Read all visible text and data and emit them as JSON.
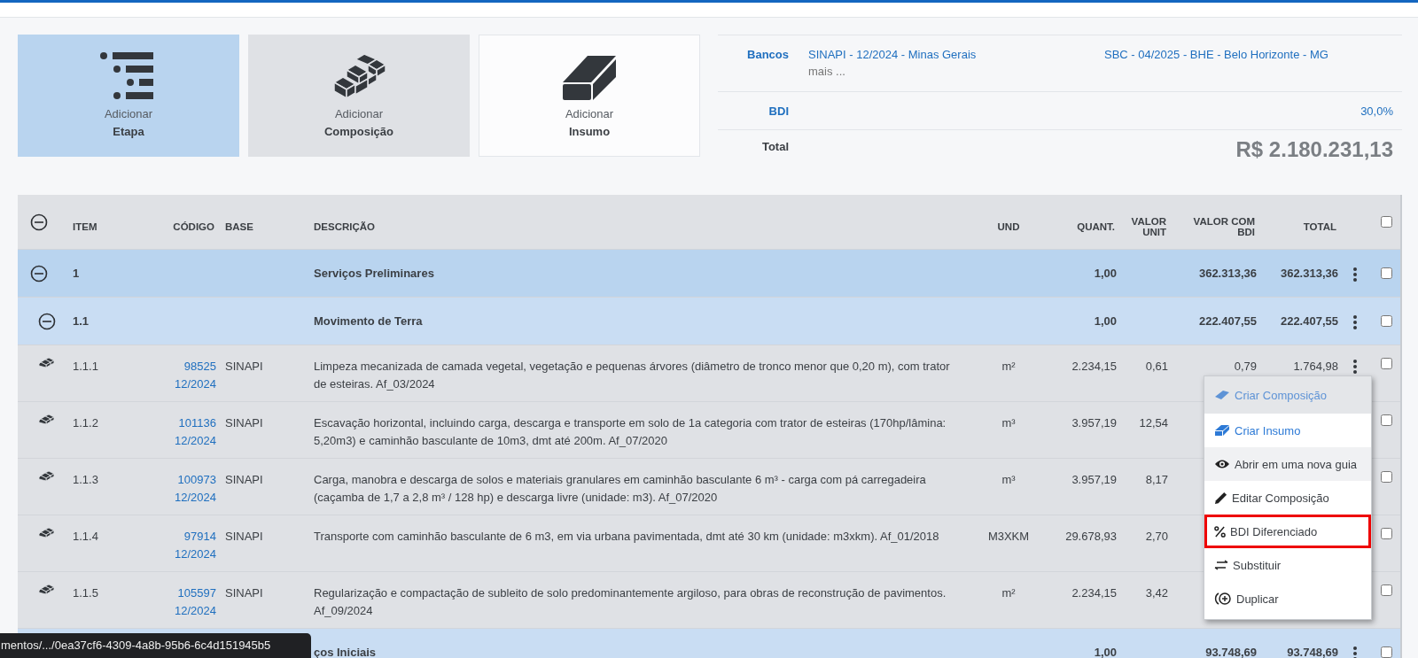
{
  "add_cards": [
    {
      "kind": "stages",
      "action": "Adicionar",
      "label": "Etapa",
      "selected": true,
      "hovered": false
    },
    {
      "kind": "bricks",
      "action": "Adicionar",
      "label": "Composição",
      "selected": false,
      "hovered": true
    },
    {
      "kind": "block",
      "action": "Adicionar",
      "label": "Insumo",
      "selected": false,
      "hovered": false
    }
  ],
  "summary": {
    "banks_label": "Bancos",
    "banks": [
      "SINAPI - 12/2024 - Minas Gerais",
      "SBC - 04/2025 - BHE - Belo Horizonte - MG"
    ],
    "more": "mais ...",
    "bdi_label": "BDI",
    "bdi": "30,0%",
    "total_label": "Total",
    "total": "R$ 2.180.231,13"
  },
  "table": {
    "header_expanded": true,
    "header_checked": false,
    "columns": [
      "ITEM",
      "CÓDIGO",
      "BASE",
      "DESCRIÇÃO",
      "UND",
      "QUANT.",
      "VALOR UNIT",
      "VALOR COM BDI",
      "TOTAL"
    ],
    "rows": [
      {
        "kind": "group",
        "item": "1",
        "description": "Serviços Preliminares",
        "quantity": "1,00",
        "value_bdi": "362.313,36",
        "total": "362.313,36",
        "expanded": true,
        "checked": false,
        "children": [
          {
            "kind": "group",
            "item": "1.1",
            "description": "Movimento de Terra",
            "quantity": "1,00",
            "value_bdi": "222.407,55",
            "total": "222.407,55",
            "expanded": true,
            "checked": false,
            "children": [
              {
                "kind": "item",
                "item": "1.1.1",
                "code": "98525",
                "version": "12/2024",
                "base": "SINAPI",
                "description": "Limpeza mecanizada de camada vegetal, vegetação e pequenas árvores (diâmetro de tronco menor que 0,20 m), com trator de esteiras. Af_03/2024",
                "unit": "m²",
                "quantity": "2.234,15",
                "unit_value": "0,61",
                "value_bdi": "0,79",
                "total": "1.764,98",
                "checked": false
              },
              {
                "kind": "item",
                "item": "1.1.2",
                "code": "101136",
                "version": "12/2024",
                "base": "SINAPI",
                "description": "Escavação horizontal, incluindo carga, descarga e transporte em solo de 1a categoria com trator de esteiras (170hp/lâmina: 5,20m3) e caminhão basculante de 10m3, dmt até 200m. Af_07/2020",
                "unit": "m³",
                "quantity": "3.957,19",
                "unit_value": "12,54",
                "checked": false
              },
              {
                "kind": "item",
                "item": "1.1.3",
                "code": "100973",
                "version": "12/2024",
                "base": "SINAPI",
                "description": "Carga, manobra e descarga de solos e materiais granulares em caminhão basculante 6 m³ - carga com pá carregadeira (caçamba de 1,7 a 2,8 m³ / 128 hp) e descarga livre (unidade: m3). Af_07/2020",
                "unit": "m³",
                "quantity": "3.957,19",
                "unit_value": "8,17",
                "checked": false
              },
              {
                "kind": "item",
                "item": "1.1.4",
                "code": "97914",
                "version": "12/2024",
                "base": "SINAPI",
                "description": "Transporte com caminhão basculante de 6 m3, em via urbana pavimentada, dmt até 30 km (unidade: m3xkm). Af_01/2018",
                "unit": "M3XKM",
                "quantity": "29.678,93",
                "unit_value": "2,70",
                "checked": false
              },
              {
                "kind": "item",
                "item": "1.1.5",
                "code": "105597",
                "version": "12/2024",
                "base": "SINAPI",
                "description": "Regularização e compactação de subleito de solo predominantemente argiloso, para obras de reconstrução de pavimentos. Af_09/2024",
                "unit": "m²",
                "quantity": "2.234,15",
                "unit_value": "3,42",
                "checked": false
              }
            ]
          },
          {
            "kind": "group",
            "description": "ços Iniciais",
            "quantity": "1,00",
            "value_bdi": "93.748,69",
            "total": "93.748,69",
            "checked": false
          }
        ]
      }
    ]
  },
  "context_menu": [
    {
      "label": "Criar Composição",
      "kind": "create",
      "disabled": true,
      "hovered": false,
      "highlighted": false
    },
    {
      "label": "Criar Insumo",
      "kind": "create",
      "disabled": false,
      "hovered": false,
      "highlighted": false
    },
    {
      "label": "Abrir em uma nova guia",
      "kind": "action",
      "disabled": false,
      "hovered": true,
      "highlighted": false
    },
    {
      "label": "Editar Composição",
      "kind": "action",
      "disabled": false,
      "hovered": false,
      "highlighted": false
    },
    {
      "label": "BDI Diferenciado",
      "kind": "action",
      "disabled": false,
      "hovered": false,
      "highlighted": true
    },
    {
      "label": "Substituir",
      "kind": "action",
      "disabled": false,
      "hovered": false,
      "highlighted": false
    },
    {
      "label": "Duplicar",
      "kind": "action",
      "disabled": false,
      "hovered": false,
      "highlighted": false
    }
  ],
  "status_url": "mentos/.../0ea37cf6-4309-4a8b-95b6-6c4d151945b5"
}
